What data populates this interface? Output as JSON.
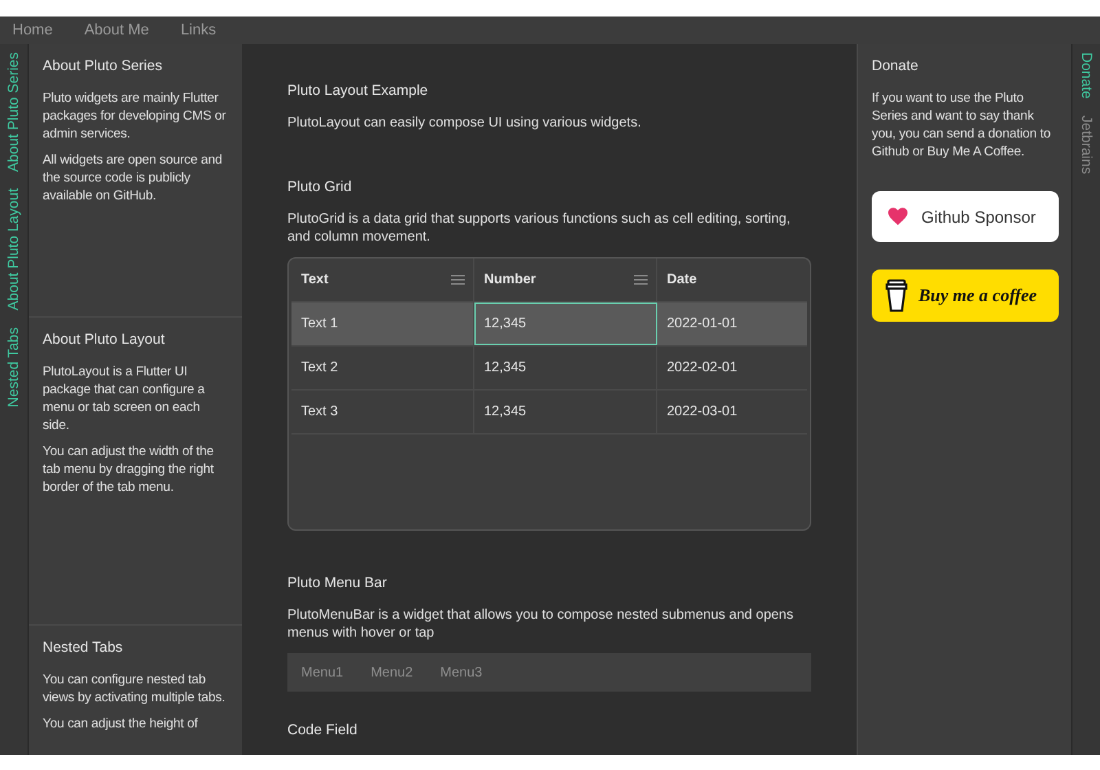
{
  "top_menu": [
    {
      "label": "Home"
    },
    {
      "label": "About Me"
    },
    {
      "label": "Links"
    }
  ],
  "left_tabs": [
    {
      "label": "About Pluto Series",
      "selected": true
    },
    {
      "label": "About Pluto Layout",
      "selected": true
    },
    {
      "label": "Nested Tabs",
      "selected": true
    }
  ],
  "left_sections": [
    {
      "title": "About Pluto Series",
      "paragraphs": [
        "Pluto widgets are mainly Flutter packages for developing CMS or admin services.",
        "All widgets are open source and the source code is publicly available on GitHub."
      ]
    },
    {
      "title": "About Pluto Layout",
      "paragraphs": [
        "PlutoLayout is a Flutter UI package that can configure a menu or tab screen on each side.",
        "You can adjust the width of the tab menu by dragging the right border of the tab menu."
      ]
    },
    {
      "title": "Nested Tabs",
      "paragraphs": [
        "You can configure nested tab views by activating multiple tabs.",
        "You can adjust the height of"
      ]
    }
  ],
  "main_sections": [
    {
      "kind": "text",
      "title": "Pluto Layout Example",
      "text": "PlutoLayout can easily compose UI using various widgets."
    },
    {
      "kind": "grid",
      "title": "Pluto Grid",
      "text": "PlutoGrid is a data grid that supports various functions such as cell editing, sorting, and column movement.",
      "columns": [
        {
          "label": "Text",
          "menu": true
        },
        {
          "label": "Number",
          "menu": true
        },
        {
          "label": "Date",
          "menu": false
        }
      ],
      "rows": [
        {
          "selected": true,
          "cells": [
            {
              "text": "Text 1",
              "current": false
            },
            {
              "text": "12,345",
              "current": true
            },
            {
              "text": "2022-01-01",
              "current": false
            }
          ]
        },
        {
          "selected": false,
          "cells": [
            {
              "text": "Text 2",
              "current": false
            },
            {
              "text": "12,345",
              "current": false
            },
            {
              "text": "2022-02-01",
              "current": false
            }
          ]
        },
        {
          "selected": false,
          "cells": [
            {
              "text": "Text 3",
              "current": false
            },
            {
              "text": "12,345",
              "current": false
            },
            {
              "text": "2022-03-01",
              "current": false
            }
          ]
        }
      ]
    },
    {
      "kind": "menubar",
      "title": "Pluto Menu Bar",
      "text": "PlutoMenuBar is a widget that allows you to compose nested submenus and opens menus with hover or tap",
      "menus": [
        "Menu1",
        "Menu2",
        "Menu3"
      ]
    },
    {
      "kind": "heading",
      "title": "Code Field"
    }
  ],
  "donate": {
    "title": "Donate",
    "text": "If you want to use the Pluto Series and want to say thank you, you can send a donation to Github or Buy Me A Coffee.",
    "buttons": [
      {
        "kind": "github",
        "label": "Github Sponsor"
      },
      {
        "kind": "coffee",
        "label": "Buy me a coffee"
      }
    ]
  },
  "right_tabs": [
    {
      "label": "Donate",
      "selected": true
    },
    {
      "label": "Jetbrains",
      "selected": false
    }
  ]
}
